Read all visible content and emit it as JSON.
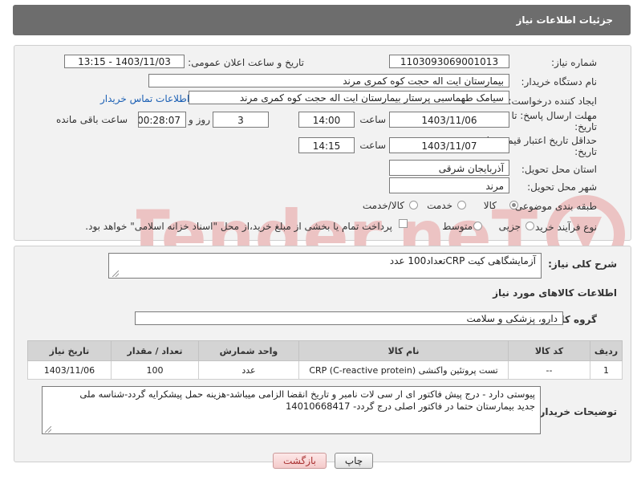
{
  "header": {
    "title": "جزئیات اطلاعات نیاز"
  },
  "fields": {
    "need_number_label": "شماره نیاز:",
    "need_number": "1103093069001013",
    "announce_label": "تاریخ و ساعت اعلان عمومی:",
    "announce_value": "1403/11/03 - 13:15",
    "buyer_org_label": "نام دستگاه خریدار:",
    "buyer_org": "بیمارستان ایت اله حجت کوه کمری مرند",
    "creator_label": "ایجاد کننده درخواست:",
    "creator": "سیامک طهماسبی پرستار بیمارستان ایت اله حجت کوه کمری مرند",
    "contact_link": "اطلاعات تماس خریدار",
    "reply_deadline_label_1": "مهلت ارسال پاسخ: تا",
    "reply_deadline_label_2": "تاریخ:",
    "reply_date": "1403/11/06",
    "time_label": "ساعت",
    "reply_time": "14:00",
    "days_value": "3",
    "days_label": "روز و",
    "remaining_time": "00:28:07",
    "remaining_label": "ساعت باقی مانده",
    "price_validity_label_1": "حداقل تاریخ اعتبار قیمت: تا",
    "price_validity_label_2": "تاریخ:",
    "price_date": "1403/11/07",
    "price_time": "14:15",
    "province_label": "استان محل تحویل:",
    "province": "آذربایجان شرقی",
    "city_label": "شهر محل تحویل:",
    "city": "مرند",
    "category_label": "طبقه بندی موضوعی:",
    "category_options": [
      "کالا",
      "خدمت",
      "کالا/خدمت"
    ],
    "category_selected": "کالا",
    "process_label": "نوع فرآیند خرید :",
    "process_options": [
      "جزیی",
      "متوسط"
    ],
    "process_selected": "جزیی",
    "payment_note": "پرداخت تمام یا بخشی از مبلغ خرید،از محل \"اسناد خزانه اسلامی\" خواهد بود."
  },
  "description": {
    "label": "شرح کلی نیاز:",
    "value": "آزمایشگاهی کیت CRPتعداد100 عدد"
  },
  "goods_section": {
    "title": "اطلاعات کالاهای مورد نیاز",
    "group_label": "گروه کالا:",
    "group_value": "دارو، پزشکی و سلامت"
  },
  "table": {
    "headers": [
      "ردیف",
      "کد کالا",
      "نام کالا",
      "واحد شمارش",
      "تعداد / مقدار",
      "تاریخ نیاز"
    ],
    "rows": [
      [
        "1",
        "--",
        "تست پروتئین واکنشی (CRP (C-reactive protein",
        "عدد",
        "100",
        "1403/11/06"
      ]
    ]
  },
  "buyer_notes": {
    "label": "توضیحات خریدار:",
    "line1": "پیوستی دارد - درج پیش فاکتور ای ار سی لات نامبر و تاریخ انقضا الزامی میباشد-هزینه حمل پیشکرایه گردد-شناسه ملی",
    "line2": "جدید بیمارستان حتما در فاکتور اصلی درج  گردد-  14010668417"
  },
  "buttons": {
    "print": "چاپ",
    "back": "بازگشت"
  },
  "colors": {
    "header_bg": "#6d6d6d",
    "panel_bg": "#f2f2f2",
    "watermark": "#e8b7b7"
  }
}
